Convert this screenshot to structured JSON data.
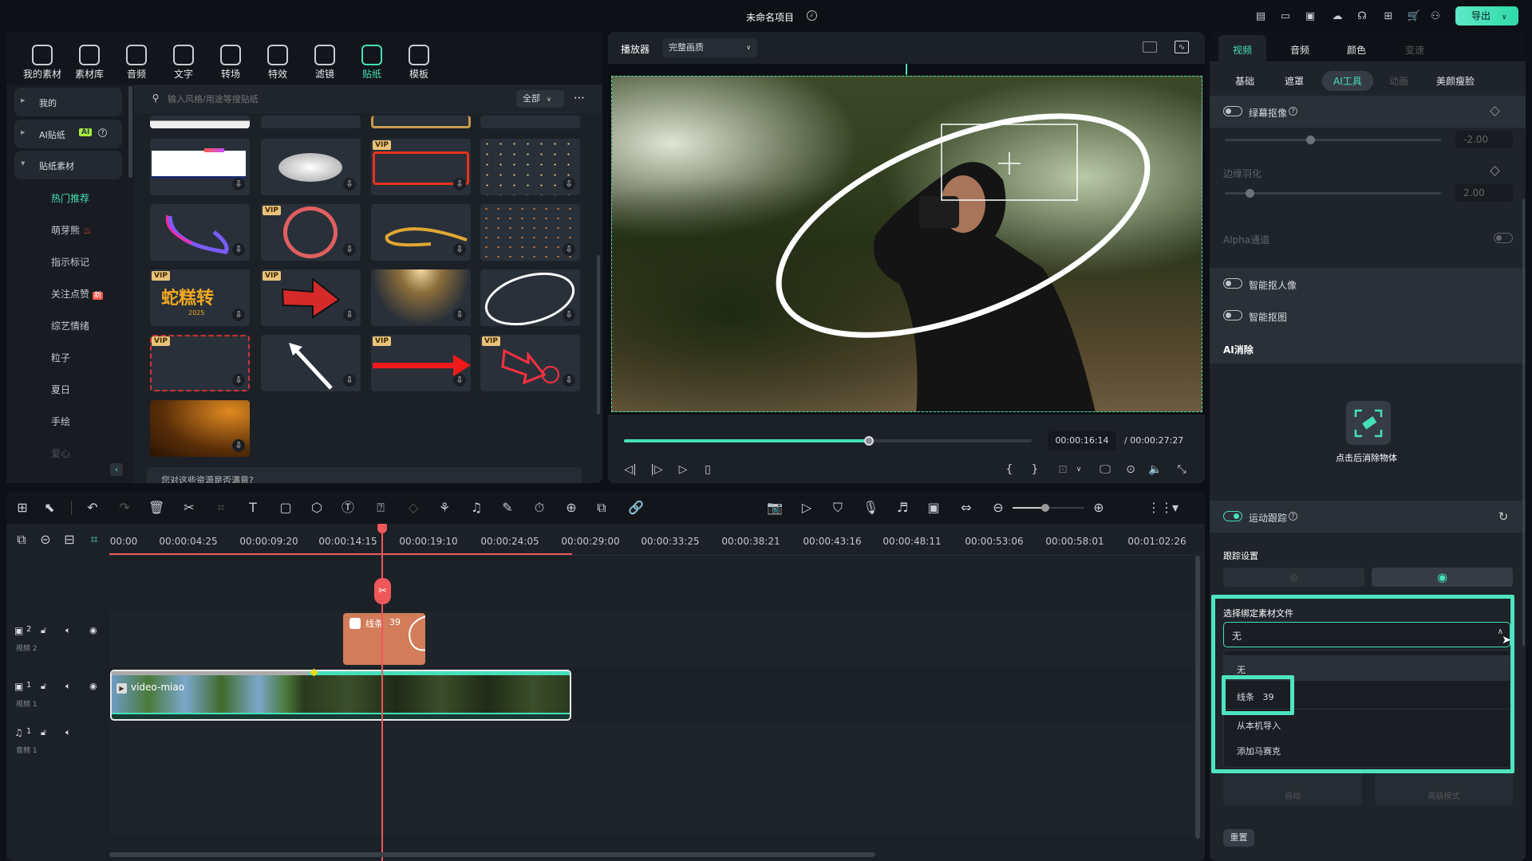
{
  "titlebar": {
    "project_title": "未命名项目",
    "export_label": "导出",
    "icons": [
      "task-icon",
      "layout-icon",
      "save-icon",
      "cloud-icon",
      "support-icon",
      "apps-icon",
      "cart-icon",
      "user-icon"
    ]
  },
  "media_tabs": [
    {
      "label": "我的素材"
    },
    {
      "label": "素材库"
    },
    {
      "label": "音频"
    },
    {
      "label": "文字"
    },
    {
      "label": "转场"
    },
    {
      "label": "特效"
    },
    {
      "label": "滤镜"
    },
    {
      "label": "贴纸",
      "active": true
    },
    {
      "label": "模板"
    }
  ],
  "sidebar": {
    "groups": [
      {
        "label": "我的"
      },
      {
        "label": "AI贴纸",
        "badge": "AI"
      },
      {
        "label": "贴纸素材"
      }
    ],
    "items": [
      {
        "label": "热门推荐",
        "active": true
      },
      {
        "label": "萌芽熊",
        "badge": "fire"
      },
      {
        "label": "指示标记"
      },
      {
        "label": "关注点赞",
        "badge": "新"
      },
      {
        "label": "综艺情绪"
      },
      {
        "label": "粒子"
      },
      {
        "label": "夏日"
      },
      {
        "label": "手绘"
      },
      {
        "label": "爱心"
      }
    ]
  },
  "search": {
    "placeholder": "输入风格/用途等搜贴纸",
    "filter": "全部"
  },
  "stickers": [
    {
      "kind": "banner",
      "vip": false
    },
    {
      "kind": "cloud",
      "vip": false
    },
    {
      "kind": "red-frame",
      "vip": true
    },
    {
      "kind": "sparkles",
      "vip": false
    },
    {
      "kind": "swoosh",
      "vip": false
    },
    {
      "kind": "red-ring",
      "vip": true
    },
    {
      "kind": "gold-stroke",
      "vip": false
    },
    {
      "kind": "orange-sparkles",
      "vip": false
    },
    {
      "kind": "snake-text",
      "vip": true,
      "text": "蛇糕转",
      "sub": "2025"
    },
    {
      "kind": "red-arrow",
      "vip": true
    },
    {
      "kind": "light-rays",
      "vip": false
    },
    {
      "kind": "white-ellipse",
      "vip": false
    },
    {
      "kind": "dashed-frame",
      "vip": true
    },
    {
      "kind": "white-arrow",
      "vip": false
    },
    {
      "kind": "red-line-arrow",
      "vip": true
    },
    {
      "kind": "neon-arrow",
      "vip": true
    },
    {
      "kind": "gold-smoke",
      "vip": false
    }
  ],
  "vip_label": "VIP",
  "feedback_text": "您对这些资源是否满意?",
  "player": {
    "label": "播放器",
    "quality": "完整画质",
    "current_time": "00:00:16:14",
    "total_time": "/ 00:00:27:27",
    "progress": 0.6
  },
  "inspector": {
    "tabs": [
      {
        "label": "视频",
        "active": true
      },
      {
        "label": "音频"
      },
      {
        "label": "颜色"
      },
      {
        "label": "变速",
        "disabled": true
      }
    ],
    "subtabs": [
      {
        "label": "基础"
      },
      {
        "label": "遮罩"
      },
      {
        "label": "AI工具",
        "active": true
      },
      {
        "label": "动画",
        "disabled": true
      },
      {
        "label": "美颜瘦脸"
      }
    ],
    "chroma_key": {
      "label": "绿幕抠像",
      "enabled": false,
      "value": "-2.00",
      "slider": 0.4
    },
    "edge_feather": {
      "label": "边缘羽化",
      "value": "2.00",
      "slider": 0.11
    },
    "alpha": {
      "label": "Alpha通道",
      "enabled": false
    },
    "smart_portrait": {
      "label": "智能抠人像",
      "enabled": false
    },
    "smart_cutout": {
      "label": "智能抠图",
      "enabled": false
    },
    "ai_erase": {
      "title": "AI消除",
      "action": "点击后消除物体"
    },
    "motion_tracking": {
      "label": "运动跟踪",
      "enabled": true
    },
    "tracking_settings": {
      "label": "跟踪设置"
    },
    "bind": {
      "label": "选择绑定素材文件",
      "value": "无",
      "options": [
        "无",
        "线条   39",
        "从本机导入",
        "添加马赛克"
      ]
    },
    "modes": [
      "自动",
      "高级模式"
    ],
    "reset": "重置"
  },
  "timeline": {
    "ruler": [
      "00:00",
      "00:00:04:25",
      "00:00:09:20",
      "00:00:14:15",
      "00:00:19:10",
      "00:00:24:05",
      "00:00:29:00",
      "00:00:33:25",
      "00:00:38:21",
      "00:00:43:16",
      "00:00:48:11",
      "00:00:53:06",
      "00:00:58:01",
      "00:01:02:26"
    ],
    "tracks": [
      {
        "num": "2",
        "name": "视频 2"
      },
      {
        "num": "1",
        "name": "视频 1"
      },
      {
        "num": "1",
        "name": "音频 1"
      }
    ],
    "sticker_clip": {
      "label": "线条",
      "num": "39"
    },
    "video_clip": {
      "label": "video-miao"
    },
    "zoom": 0.55
  },
  "colors": {
    "accent": "#45e0b8",
    "playhead": "#f0575a",
    "highlight": "#4fe3c1",
    "clip": "#d27c5a"
  }
}
